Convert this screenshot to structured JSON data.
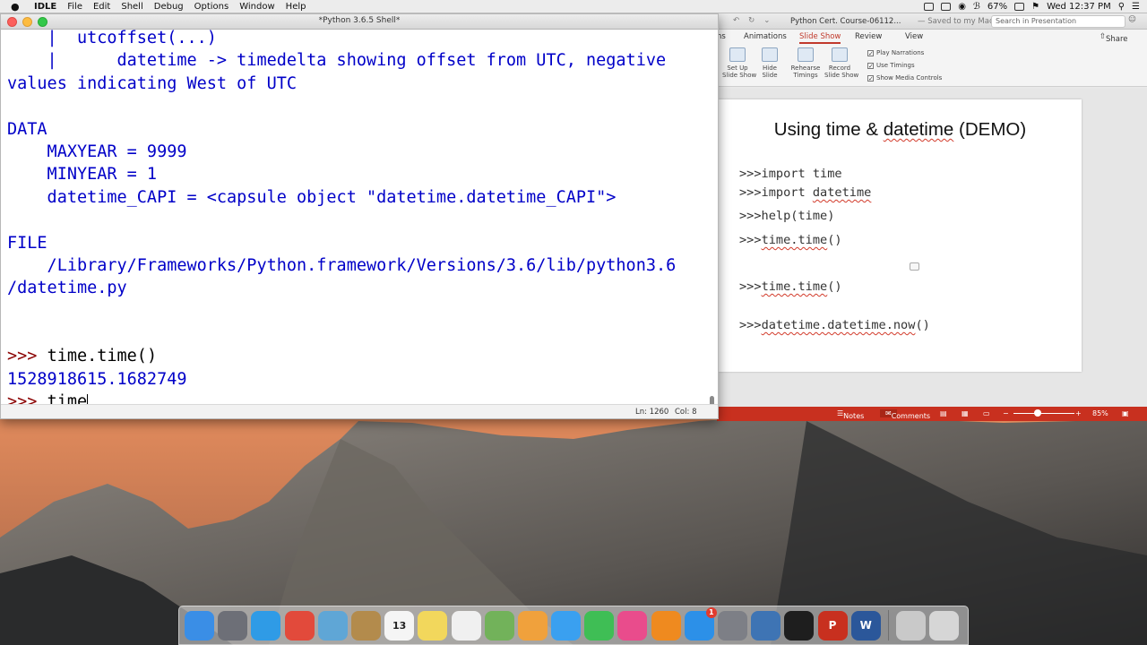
{
  "menubar": {
    "app_name": "IDLE",
    "menus": [
      "File",
      "Edit",
      "Shell",
      "Debug",
      "Options",
      "Window",
      "Help"
    ],
    "battery": "67%",
    "clock": "Wed 12:37 PM"
  },
  "idle": {
    "window_title": "*Python 3.6.5 Shell*",
    "lines": [
      {
        "t": "output",
        "text": "    |  utcoffset(...)"
      },
      {
        "t": "output",
        "text": "    |      datetime -> timedelta showing offset from UTC, negative"
      },
      {
        "t": "output",
        "text": "values indicating West of UTC"
      },
      {
        "t": "output",
        "text": ""
      },
      {
        "t": "output",
        "text": "DATA"
      },
      {
        "t": "output",
        "text": "    MAXYEAR = 9999"
      },
      {
        "t": "output",
        "text": "    MINYEAR = 1"
      },
      {
        "t": "output",
        "text": "    datetime_CAPI = <capsule object \"datetime.datetime_CAPI\">"
      },
      {
        "t": "output",
        "text": ""
      },
      {
        "t": "output",
        "text": "FILE"
      },
      {
        "t": "output",
        "text": "    /Library/Frameworks/Python.framework/Versions/3.6/lib/python3.6"
      },
      {
        "t": "output",
        "text": "/datetime.py"
      },
      {
        "t": "output",
        "text": ""
      },
      {
        "t": "output",
        "text": ""
      },
      {
        "t": "prompt",
        "prompt": ">>> ",
        "input": "time.time()"
      },
      {
        "t": "output",
        "text": "1528918615.1682749"
      },
      {
        "t": "current",
        "prompt": ">>> ",
        "input": "time"
      }
    ],
    "status_ln": "Ln: 1260",
    "status_col": "Col: 8"
  },
  "ppt": {
    "doc_title": "Python Cert. Course-06112...",
    "saved_status": "— Saved to my Mac",
    "search_placeholder": "Search in Presentation",
    "tabs": [
      "ns",
      "Animations",
      "Slide Show",
      "Review",
      "View"
    ],
    "active_tab": "Slide Show",
    "share_label": "Share",
    "ribbon": {
      "set_up": "Set Up\nSlide Show",
      "hide": "Hide\nSlide",
      "rehearse": "Rehearse\nTimings",
      "record": "Record\nSlide Show",
      "checks": [
        "Play Narrations",
        "Use Timings",
        "Show Media Controls"
      ]
    },
    "slide": {
      "title_pre": "Using time & ",
      "title_word": "datetime",
      "title_post": " (DEMO)",
      "lines": [
        {
          "pre": ">>>import time",
          "und": ""
        },
        {
          "pre": ">>>import ",
          "und": "datetime"
        },
        {
          "pre": ">>>help(time)",
          "und": ""
        },
        {
          "pre": ">>>",
          "und": "time.time",
          "post": "()"
        },
        {
          "pre": ">>>",
          "und": "time.time",
          "post": "()"
        },
        {
          "pre": ">>>",
          "und": "datetime.datetime.now",
          "post": "()"
        }
      ]
    },
    "status": {
      "notes": "Notes",
      "comments": "Comments",
      "zoom": "85%"
    }
  },
  "dock": {
    "items": [
      {
        "name": "finder-icon",
        "label": "",
        "color": "#3a8ee6"
      },
      {
        "name": "launchpad-icon",
        "label": "",
        "color": "#6d6f77"
      },
      {
        "name": "safari-icon",
        "label": "",
        "color": "#2f9be6"
      },
      {
        "name": "chrome-icon",
        "label": "",
        "color": "#e24a3b"
      },
      {
        "name": "preview-icon",
        "label": "",
        "color": "#5fa6d6"
      },
      {
        "name": "contacts-icon",
        "label": "",
        "color": "#b38b4c"
      },
      {
        "name": "calendar-icon",
        "label": "13",
        "color": "#f5f5f5"
      },
      {
        "name": "notes-icon",
        "label": "",
        "color": "#f2d75c"
      },
      {
        "name": "reminders-icon",
        "label": "",
        "color": "#f0f0f0"
      },
      {
        "name": "maps-icon",
        "label": "",
        "color": "#72b25a"
      },
      {
        "name": "photos-icon",
        "label": "",
        "color": "#f0a13c"
      },
      {
        "name": "messages-icon",
        "label": "",
        "color": "#3aa0f0"
      },
      {
        "name": "facetime-icon",
        "label": "",
        "color": "#3fbe55"
      },
      {
        "name": "itunes-icon",
        "label": "",
        "color": "#e94c8c"
      },
      {
        "name": "ibooks-icon",
        "label": "",
        "color": "#ef8a1f"
      },
      {
        "name": "app-store-icon",
        "label": "",
        "color": "#2c90e8",
        "badge": "1"
      },
      {
        "name": "system-preferences-icon",
        "label": "",
        "color": "#7d7f86"
      },
      {
        "name": "python-launcher-icon",
        "label": "",
        "color": "#3e74b4"
      },
      {
        "name": "terminal-icon",
        "label": "",
        "color": "#1e1e1e"
      },
      {
        "name": "powerpoint-icon",
        "label": "P",
        "color": "#c8301f"
      },
      {
        "name": "word-icon",
        "label": "W",
        "color": "#2b579a"
      },
      {
        "name": "downloads-stack-icon",
        "label": "",
        "color": "#c9c9c9"
      },
      {
        "name": "trash-icon",
        "label": "",
        "color": "#d6d6d6"
      }
    ]
  }
}
